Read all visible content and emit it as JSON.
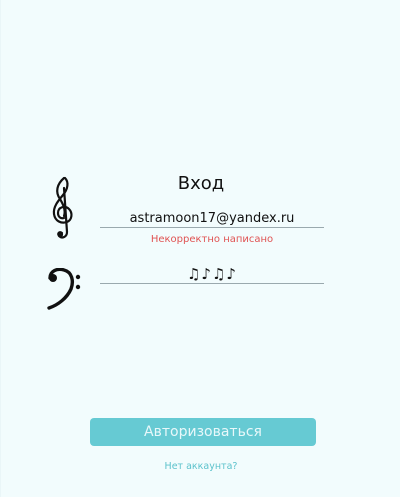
{
  "login": {
    "title": "Вход",
    "email_value": "astramoon17@yandex.ru",
    "email_error": "Некорректно написано",
    "password_value": "♫♪♫♪",
    "submit_label": "Авторизоваться",
    "signup_link": "Нет аккаунта?"
  },
  "icons": {
    "email_field_icon": "treble-clef-icon",
    "password_field_icon": "bass-clef-icon"
  },
  "colors": {
    "accent": "#66cad3",
    "link": "#5cc2cc",
    "error": "#e05353",
    "background": "#f2fcfd"
  }
}
